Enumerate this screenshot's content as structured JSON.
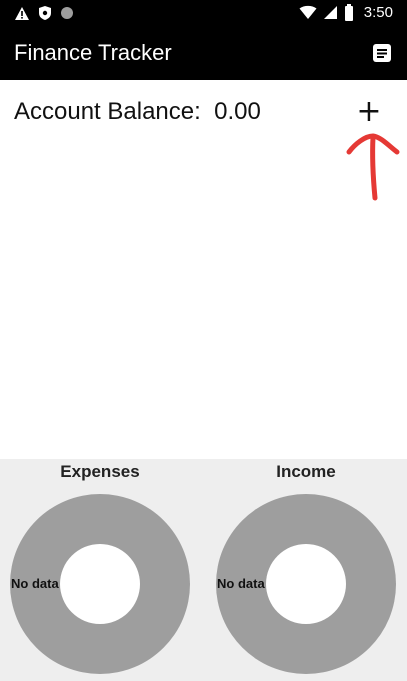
{
  "status_bar": {
    "time": "3:50",
    "icons": [
      "warning-icon",
      "shield-icon",
      "dot-icon",
      "wifi-icon",
      "signal-icon",
      "battery-icon"
    ]
  },
  "app_bar": {
    "title": "Finance Tracker",
    "menu_icon": "list-icon"
  },
  "balance": {
    "label": "Account Balance:",
    "value": "0.00",
    "add_label": "+"
  },
  "annotation": {
    "color": "#e53935",
    "icon": "arrow-up-icon"
  },
  "charts": [
    {
      "title": "Expenses",
      "empty_text": "No data"
    },
    {
      "title": "Income",
      "empty_text": "No data"
    }
  ],
  "colors": {
    "app_bar": "#000000",
    "chart_panel": "#eeeeee",
    "donut": "#9e9e9e"
  }
}
